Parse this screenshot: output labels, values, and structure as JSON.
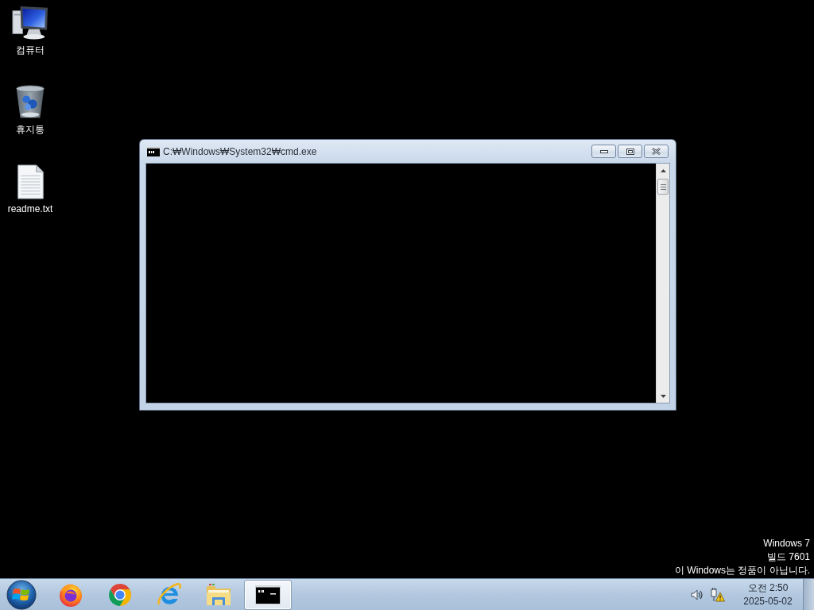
{
  "desktop": {
    "icons": [
      {
        "kind": "computer",
        "label": "컴퓨터"
      },
      {
        "kind": "recycle_bin",
        "label": "휴지통"
      },
      {
        "kind": "text_file",
        "label": "readme.txt"
      }
    ],
    "notice": [
      "Windows 7",
      "빌드 7601",
      "이 Windows는 정품이 아닙니다."
    ]
  },
  "window": {
    "title": "C:₩Windows₩System32₩cmd.exe",
    "controls": [
      {
        "kind": "minimize"
      },
      {
        "kind": "maximize"
      },
      {
        "kind": "close"
      }
    ]
  },
  "taskbar": {
    "apps": [
      {
        "kind": "firefox",
        "selected": false
      },
      {
        "kind": "chrome",
        "selected": false
      },
      {
        "kind": "ie",
        "selected": false
      },
      {
        "kind": "explorer",
        "selected": false
      },
      {
        "kind": "cmd",
        "selected": true
      }
    ],
    "tray": [
      {
        "kind": "volume"
      },
      {
        "kind": "network_warning"
      }
    ],
    "clock": {
      "time": "오전 2:50",
      "date": "2025-05-02"
    }
  }
}
